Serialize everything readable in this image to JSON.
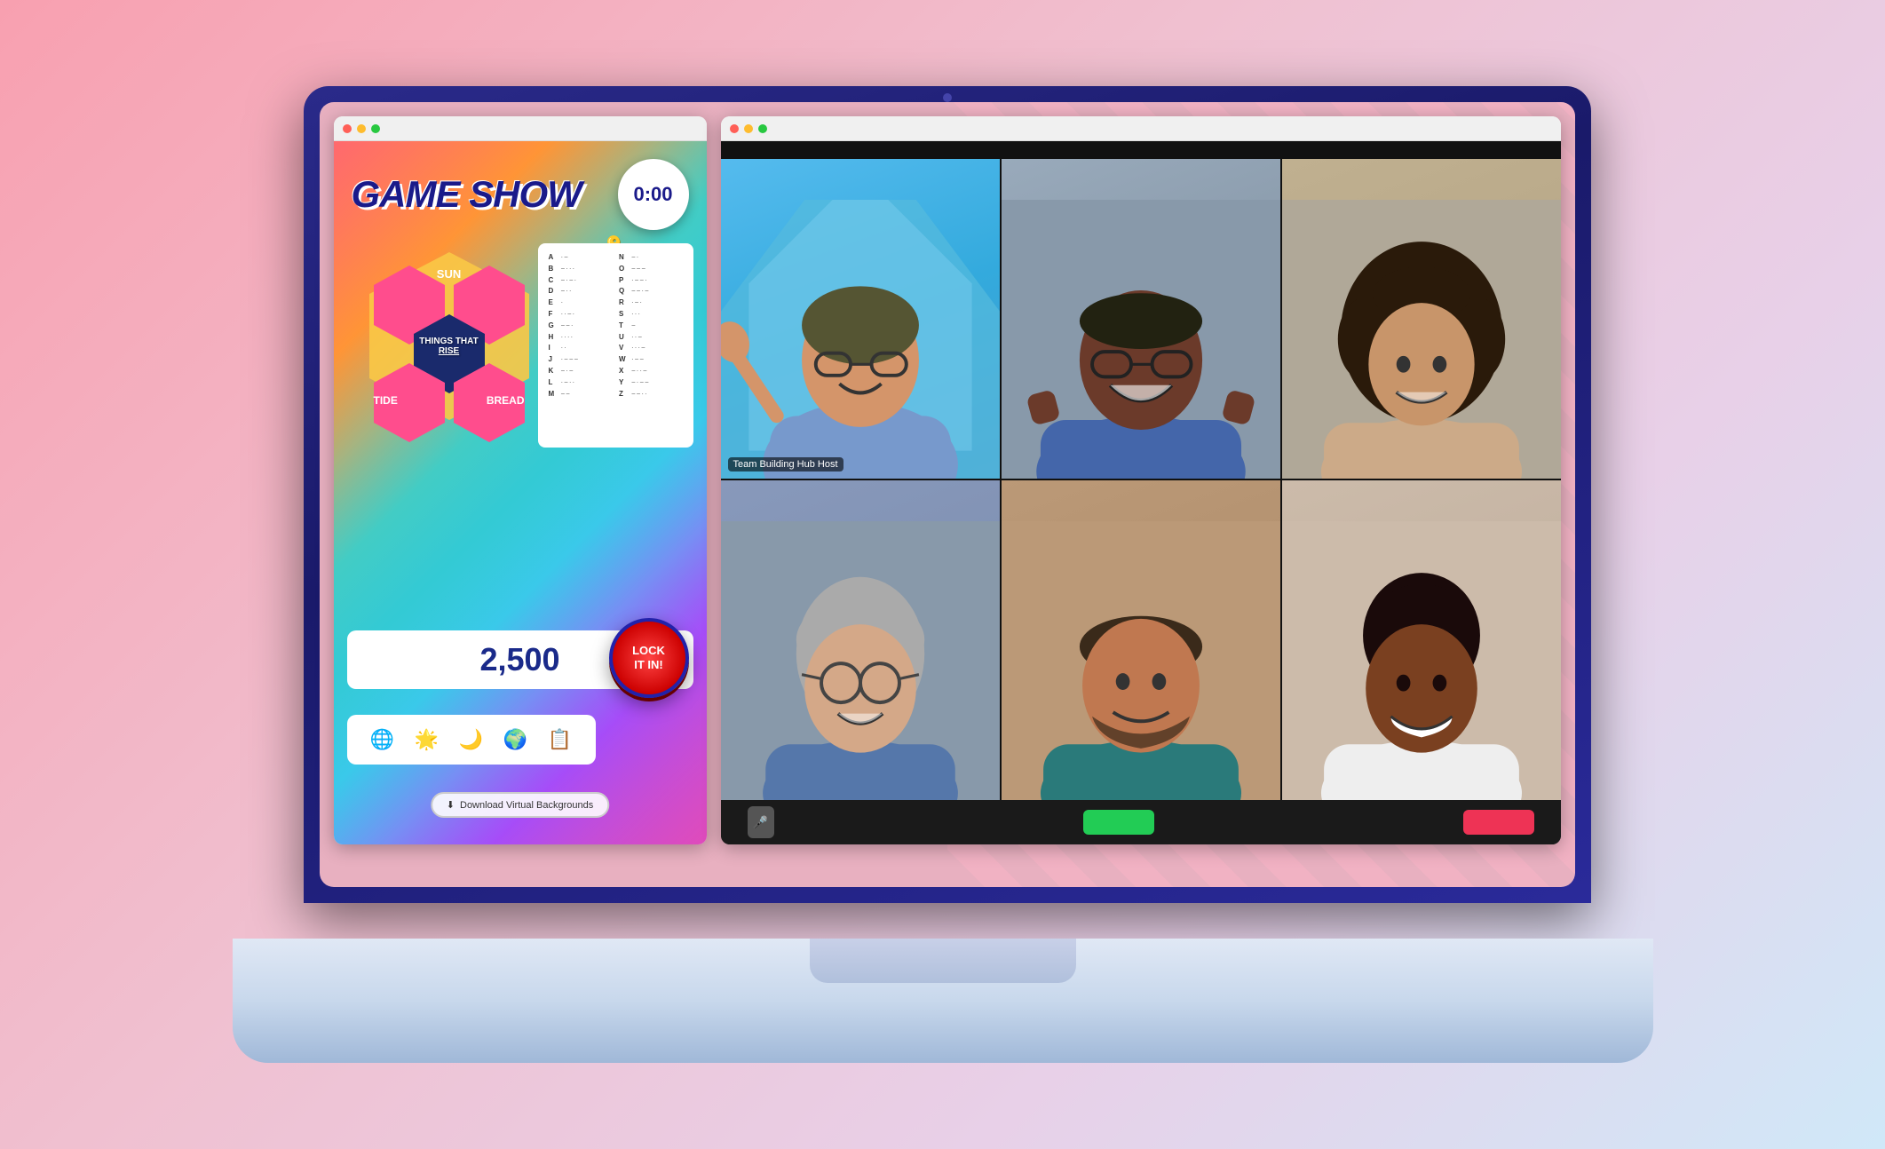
{
  "laptop": {
    "camera_label": "camera"
  },
  "left_browser": {
    "titlebar_dots": [
      "red",
      "yellow",
      "green"
    ],
    "game_show_title": "GAME SHOW",
    "timer": "0:00",
    "hex_labels": {
      "top": "SUN",
      "center": "THINGS THAT\nRISE",
      "left": "TIDE",
      "right": "BREAD"
    },
    "morse_icon": "🔑",
    "morse_data": [
      {
        "letter": "A",
        "code": "·−"
      },
      {
        "letter": "B",
        "code": "−···"
      },
      {
        "letter": "C",
        "code": "−·−·"
      },
      {
        "letter": "D",
        "code": "−··"
      },
      {
        "letter": "E",
        "code": "·"
      },
      {
        "letter": "F",
        "code": "··−·"
      },
      {
        "letter": "G",
        "code": "−−·"
      },
      {
        "letter": "H",
        "code": "····"
      },
      {
        "letter": "I",
        "code": "··"
      },
      {
        "letter": "J",
        "code": "·−−−"
      },
      {
        "letter": "K",
        "code": "−·−"
      },
      {
        "letter": "L",
        "code": "·−··"
      },
      {
        "letter": "M",
        "code": "−−"
      },
      {
        "letter": "N",
        "code": "−·"
      },
      {
        "letter": "O",
        "code": "−−−"
      },
      {
        "letter": "P",
        "code": "·−−·"
      },
      {
        "letter": "Q",
        "code": "−−·−"
      },
      {
        "letter": "R",
        "code": "·−·"
      },
      {
        "letter": "S",
        "code": "···"
      },
      {
        "letter": "T",
        "code": "−"
      },
      {
        "letter": "U",
        "code": "··−"
      },
      {
        "letter": "V",
        "code": "···−"
      },
      {
        "letter": "W",
        "code": "·−−"
      },
      {
        "letter": "X",
        "code": "−··−"
      },
      {
        "letter": "Y",
        "code": "−·−−"
      },
      {
        "letter": "Z",
        "code": "−−··"
      }
    ],
    "score": "2,500",
    "lock_button_line1": "LOCK",
    "lock_button_line2": "IT IN!",
    "icons": [
      "🌐",
      "🌟",
      "🌙",
      "🌍",
      "📋"
    ],
    "download_button": "Download Virtual Backgrounds"
  },
  "right_browser": {
    "titlebar_dots": [
      "red",
      "yellow",
      "green"
    ],
    "video_participants": [
      {
        "id": 1,
        "label": "Team Building Hub Host",
        "emoji": "👨"
      },
      {
        "id": 2,
        "label": "",
        "emoji": "👨"
      },
      {
        "id": 3,
        "label": "",
        "emoji": "👩"
      },
      {
        "id": 4,
        "label": "",
        "emoji": "👩"
      },
      {
        "id": 5,
        "label": "",
        "emoji": "👨"
      },
      {
        "id": 6,
        "label": "",
        "emoji": "👩"
      }
    ],
    "controls": {
      "mic_icon": "🎤",
      "green_btn_label": "",
      "red_btn_label": ""
    }
  }
}
